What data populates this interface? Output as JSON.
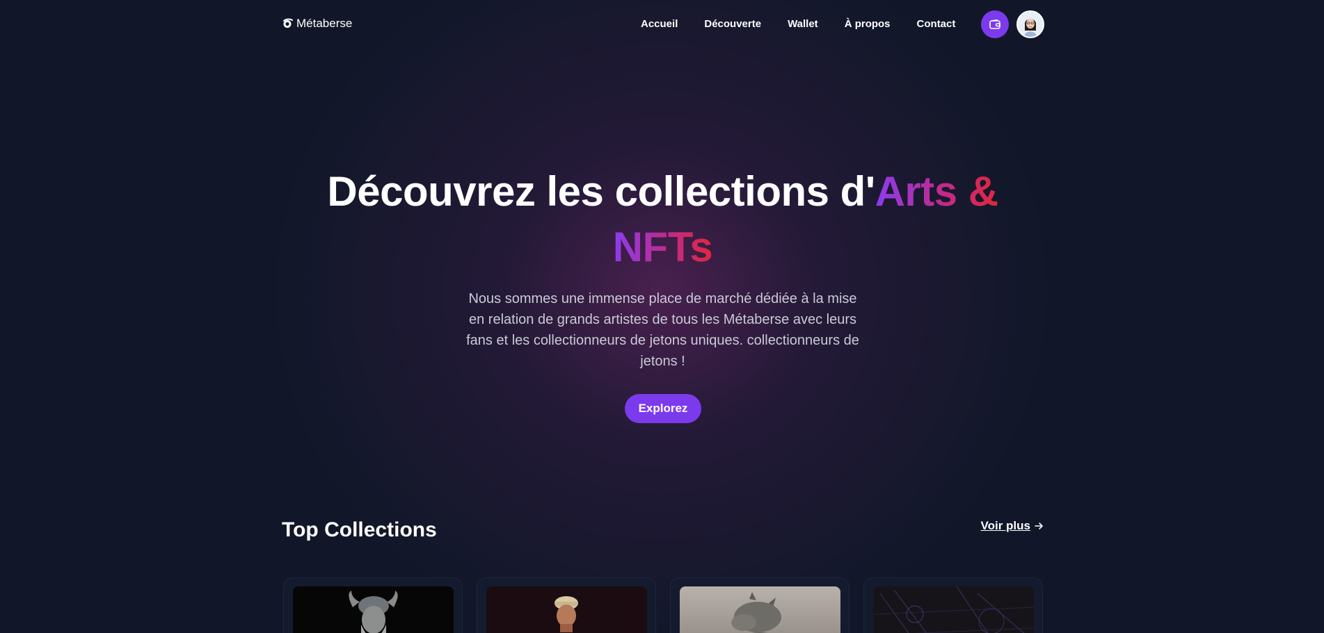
{
  "brand": {
    "name": "Métaberse",
    "icon": "planet-logo-icon"
  },
  "nav": {
    "items": [
      {
        "label": "Accueil"
      },
      {
        "label": "Découverte"
      },
      {
        "label": "Wallet"
      },
      {
        "label": "À propos"
      },
      {
        "label": "Contact"
      }
    ],
    "wallet_icon": "wallet-icon",
    "avatar_icon": "user-avatar"
  },
  "hero": {
    "title_plain": "Découvrez les collections d'",
    "title_highlight_1": "Arts &",
    "title_highlight_2": "NFTs",
    "description": "Nous sommes une immense place de marché dédiée à la mise en relation de grands artistes de tous les Métaberse avec leurs fans et les collectionneurs de jetons uniques. collectionneurs de jetons !",
    "cta_label": "Explorez"
  },
  "collections": {
    "title": "Top Collections",
    "see_more": "Voir plus",
    "see_more_icon": "arrow-right-icon",
    "cards": [
      {
        "image": "viking-warrior-bust"
      },
      {
        "image": "man-with-cap-bust"
      },
      {
        "image": "grey-creature-sculpture"
      },
      {
        "image": "dark-abstract-art"
      }
    ]
  },
  "colors": {
    "background": "#111729",
    "accent": "#7c3aed",
    "gradient_start": "#8b3cf0",
    "gradient_end": "#e0283c"
  }
}
